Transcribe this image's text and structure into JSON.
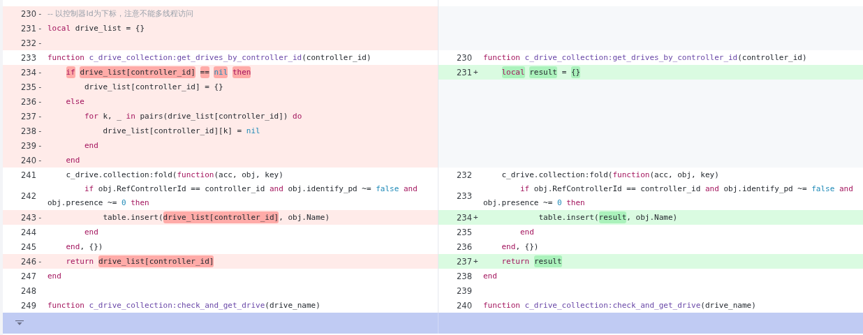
{
  "rows": [
    {
      "left": {
        "number": "230",
        "sign": "-",
        "kind": "removed",
        "tokens": [
          {
            "text": "-- 以控制器Id为下标，注意不能多线程访问",
            "kind": "comment",
            "highlight": false
          }
        ]
      }
    },
    {
      "left": {
        "number": "231",
        "sign": "-",
        "kind": "removed",
        "tokens": [
          {
            "text": "local",
            "kind": "keyword",
            "highlight": false
          },
          {
            "text": " drive_list = {}",
            "kind": "plain",
            "highlight": false
          }
        ]
      }
    },
    {
      "left": {
        "number": "232",
        "sign": "-",
        "kind": "removed"
      }
    },
    {
      "left": {
        "number": "233",
        "kind": "context",
        "tokens": [
          {
            "text": "function",
            "kind": "keyword",
            "highlight": false
          },
          {
            "text": " c_drive_collection:get_drives_by_controller_id",
            "kind": "function",
            "highlight": false
          },
          {
            "text": "(controller_id)",
            "kind": "plain",
            "highlight": false
          }
        ]
      },
      "right": {
        "number": "230",
        "kind": "context",
        "tokens": [
          {
            "text": "function",
            "kind": "keyword",
            "highlight": false
          },
          {
            "text": " c_drive_collection:get_drives_by_controller_id",
            "kind": "function",
            "highlight": false
          },
          {
            "text": "(controller_id)",
            "kind": "plain",
            "highlight": false
          }
        ]
      }
    },
    {
      "left": {
        "number": "234",
        "sign": "-",
        "kind": "removed",
        "tokens": [
          {
            "text": "    if",
            "kind": "keyword",
            "highlight": true
          },
          {
            "text": " drive_list[controller_id]",
            "kind": "plain",
            "highlight": true
          },
          {
            "text": " ==",
            "kind": "plain",
            "highlight": true
          },
          {
            "text": " nil",
            "kind": "constant",
            "highlight": true
          },
          {
            "text": " then",
            "kind": "keyword",
            "highlight": true
          }
        ]
      },
      "right": {
        "number": "231",
        "sign": "+",
        "kind": "added",
        "tokens": [
          {
            "text": "    local",
            "kind": "keyword",
            "highlight": true
          },
          {
            "text": " result",
            "kind": "plain",
            "highlight": true
          },
          {
            "text": " =",
            "kind": "plain",
            "highlight": false
          },
          {
            "text": " {}",
            "kind": "plain",
            "highlight": true
          }
        ]
      }
    },
    {
      "left": {
        "number": "235",
        "sign": "-",
        "kind": "removed",
        "tokens": [
          {
            "text": "        drive_list[controller_id] = {}",
            "kind": "plain",
            "highlight": false
          }
        ]
      }
    },
    {
      "left": {
        "number": "236",
        "sign": "-",
        "kind": "removed",
        "tokens": [
          {
            "text": "    else",
            "kind": "keyword",
            "highlight": false
          }
        ]
      }
    },
    {
      "left": {
        "number": "237",
        "sign": "-",
        "kind": "removed",
        "tokens": [
          {
            "text": "        for",
            "kind": "keyword",
            "highlight": false
          },
          {
            "text": " k, _ ",
            "kind": "plain",
            "highlight": false
          },
          {
            "text": "in",
            "kind": "keyword",
            "highlight": false
          },
          {
            "text": " pairs(drive_list[controller_id]) ",
            "kind": "plain",
            "highlight": false
          },
          {
            "text": "do",
            "kind": "keyword",
            "highlight": false
          }
        ]
      }
    },
    {
      "left": {
        "number": "238",
        "sign": "-",
        "kind": "removed",
        "tokens": [
          {
            "text": "            drive_list[controller_id][k] = ",
            "kind": "plain",
            "highlight": false
          },
          {
            "text": "nil",
            "kind": "constant",
            "highlight": false
          }
        ]
      }
    },
    {
      "left": {
        "number": "239",
        "sign": "-",
        "kind": "removed",
        "tokens": [
          {
            "text": "        end",
            "kind": "keyword",
            "highlight": false
          }
        ]
      }
    },
    {
      "left": {
        "number": "240",
        "sign": "-",
        "kind": "removed",
        "tokens": [
          {
            "text": "    end",
            "kind": "keyword",
            "highlight": false
          }
        ]
      }
    },
    {
      "left": {
        "number": "241",
        "kind": "context",
        "tokens": [
          {
            "text": "    c_drive.collection:fold(",
            "kind": "plain",
            "highlight": false
          },
          {
            "text": "function",
            "kind": "keyword",
            "highlight": false
          },
          {
            "text": "(acc, obj, key)",
            "kind": "plain",
            "highlight": false
          }
        ]
      },
      "right": {
        "number": "232",
        "kind": "context",
        "tokens": [
          {
            "text": "    c_drive.collection:fold(",
            "kind": "plain",
            "highlight": false
          },
          {
            "text": "function",
            "kind": "keyword",
            "highlight": false
          },
          {
            "text": "(acc, obj, key)",
            "kind": "plain",
            "highlight": false
          }
        ]
      }
    },
    {
      "left": {
        "number": "242",
        "kind": "context",
        "tokens": [
          {
            "text": "        if",
            "kind": "keyword",
            "highlight": false
          },
          {
            "text": " obj.RefControllerId == controller_id ",
            "kind": "plain",
            "highlight": false
          },
          {
            "text": "and",
            "kind": "keyword",
            "highlight": false
          },
          {
            "text": " obj.identify_pd ~= ",
            "kind": "plain",
            "highlight": false
          },
          {
            "text": "false",
            "kind": "constant",
            "highlight": false
          },
          {
            "text": " and",
            "kind": "keyword",
            "highlight": false
          },
          {
            "text": " obj.presence ~= ",
            "kind": "plain",
            "highlight": false
          },
          {
            "text": "0",
            "kind": "constant",
            "highlight": false
          },
          {
            "text": " then",
            "kind": "keyword",
            "highlight": false
          }
        ]
      },
      "right": {
        "number": "233",
        "kind": "context",
        "tokens": [
          {
            "text": "        if",
            "kind": "keyword",
            "highlight": false
          },
          {
            "text": " obj.RefControllerId == controller_id ",
            "kind": "plain",
            "highlight": false
          },
          {
            "text": "and",
            "kind": "keyword",
            "highlight": false
          },
          {
            "text": " obj.identify_pd ~= ",
            "kind": "plain",
            "highlight": false
          },
          {
            "text": "false",
            "kind": "constant",
            "highlight": false
          },
          {
            "text": " and",
            "kind": "keyword",
            "highlight": false
          },
          {
            "text": " obj.presence ~= ",
            "kind": "plain",
            "highlight": false
          },
          {
            "text": "0",
            "kind": "constant",
            "highlight": false
          },
          {
            "text": " then",
            "kind": "keyword",
            "highlight": false
          }
        ]
      }
    },
    {
      "left": {
        "number": "243",
        "sign": "-",
        "kind": "removed",
        "tokens": [
          {
            "text": "            table.insert(",
            "kind": "plain",
            "highlight": false
          },
          {
            "text": "drive_list[controller_id]",
            "kind": "plain",
            "highlight": true
          },
          {
            "text": ", obj.Name)",
            "kind": "plain",
            "highlight": false
          }
        ]
      },
      "right": {
        "number": "234",
        "sign": "+",
        "kind": "added",
        "tokens": [
          {
            "text": "            table.insert(",
            "kind": "plain",
            "highlight": false
          },
          {
            "text": "result",
            "kind": "plain",
            "highlight": true
          },
          {
            "text": ", obj.Name)",
            "kind": "plain",
            "highlight": false
          }
        ]
      }
    },
    {
      "left": {
        "number": "244",
        "kind": "context",
        "tokens": [
          {
            "text": "        end",
            "kind": "keyword",
            "highlight": false
          }
        ]
      },
      "right": {
        "number": "235",
        "kind": "context",
        "tokens": [
          {
            "text": "        end",
            "kind": "keyword",
            "highlight": false
          }
        ]
      }
    },
    {
      "left": {
        "number": "245",
        "kind": "context",
        "tokens": [
          {
            "text": "    end",
            "kind": "keyword",
            "highlight": false
          },
          {
            "text": ", {})",
            "kind": "plain",
            "highlight": false
          }
        ]
      },
      "right": {
        "number": "236",
        "kind": "context",
        "tokens": [
          {
            "text": "    end",
            "kind": "keyword",
            "highlight": false
          },
          {
            "text": ", {})",
            "kind": "plain",
            "highlight": false
          }
        ]
      }
    },
    {
      "left": {
        "number": "246",
        "sign": "-",
        "kind": "removed",
        "tokens": [
          {
            "text": "    return",
            "kind": "keyword",
            "highlight": false
          },
          {
            "text": " drive_list[controller_id]",
            "kind": "plain",
            "highlight": true
          }
        ]
      },
      "right": {
        "number": "237",
        "sign": "+",
        "kind": "added",
        "tokens": [
          {
            "text": "    return",
            "kind": "keyword",
            "highlight": false
          },
          {
            "text": " result",
            "kind": "plain",
            "highlight": true
          }
        ]
      }
    },
    {
      "left": {
        "number": "247",
        "kind": "context",
        "tokens": [
          {
            "text": "end",
            "kind": "keyword",
            "highlight": false
          }
        ]
      },
      "right": {
        "number": "238",
        "kind": "context",
        "tokens": [
          {
            "text": "end",
            "kind": "keyword",
            "highlight": false
          }
        ]
      }
    },
    {
      "left": {
        "number": "248",
        "kind": "context"
      },
      "right": {
        "number": "239",
        "kind": "context"
      }
    },
    {
      "left": {
        "number": "249",
        "kind": "context",
        "tokens": [
          {
            "text": "function",
            "kind": "keyword",
            "highlight": false
          },
          {
            "text": " c_drive_collection:check_and_get_drive",
            "kind": "function",
            "highlight": false
          },
          {
            "text": "(drive_name)",
            "kind": "plain",
            "highlight": false
          }
        ]
      },
      "right": {
        "number": "240",
        "kind": "context",
        "tokens": [
          {
            "text": "function",
            "kind": "keyword",
            "highlight": false
          },
          {
            "text": " c_drive_collection:check_and_get_drive",
            "kind": "function",
            "highlight": false
          },
          {
            "text": "(drive_name)",
            "kind": "plain",
            "highlight": false
          }
        ]
      }
    }
  ]
}
